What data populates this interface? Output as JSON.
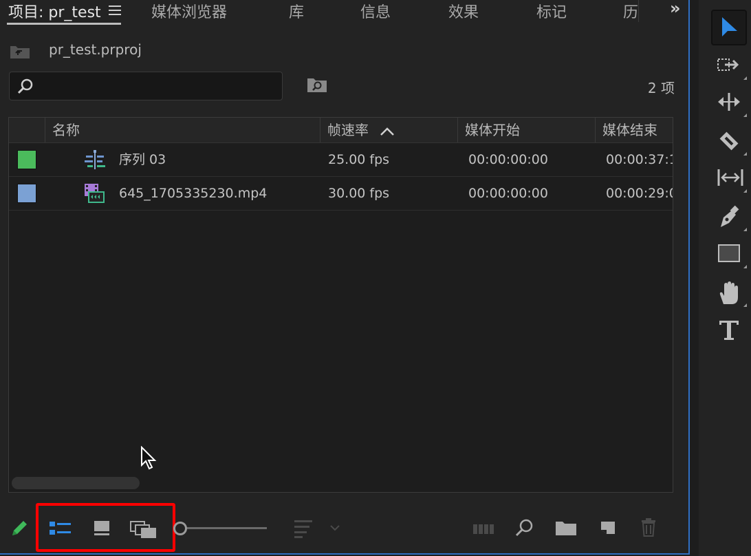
{
  "tabs": [
    {
      "label": "项目: pr_test"
    },
    {
      "label": "媒体浏览器"
    },
    {
      "label": "库"
    },
    {
      "label": "信息"
    },
    {
      "label": "效果"
    },
    {
      "label": "标记"
    },
    {
      "label": "历"
    }
  ],
  "overflow_label": "»",
  "project": {
    "file_name": "pr_test.prproj"
  },
  "search": {
    "value": "",
    "placeholder": ""
  },
  "item_count": "2 项",
  "columns": [
    "名称",
    "帧速率",
    "媒体开始",
    "媒体结束"
  ],
  "rows": [
    {
      "label_color": "#4bbb5c",
      "icon": "sequence-icon",
      "name": "序列 03",
      "frame_rate": "25.00 fps",
      "media_start": "00:00:00:00",
      "media_end": "00:00:37:1"
    },
    {
      "label_color": "#7ba1d4",
      "icon": "video-clip-icon",
      "name": "645_1705335230.mp4",
      "frame_rate": "30.00 fps",
      "media_start": "00:00:00:00",
      "media_end": "00:00:29:0"
    }
  ],
  "colors": {
    "accent": "#2f8ae5",
    "highlight": "#ff0000",
    "panel_border": "#2f6fc4"
  },
  "bottom_toolbar": [
    "pencil-icon",
    "list-view-icon",
    "icon-view-icon",
    "freeform-view-icon",
    "zoom-slider",
    "sort-icon",
    "automate-icon",
    "find-icon",
    "new-bin-icon",
    "new-item-icon",
    "trash-icon"
  ],
  "tools": [
    "selection-tool-icon",
    "track-select-tool-icon",
    "ripple-edit-tool-icon",
    "razor-tool-icon",
    "slip-tool-icon",
    "pen-tool-icon",
    "rectangle-tool-icon",
    "hand-tool-icon",
    "type-tool-icon"
  ]
}
